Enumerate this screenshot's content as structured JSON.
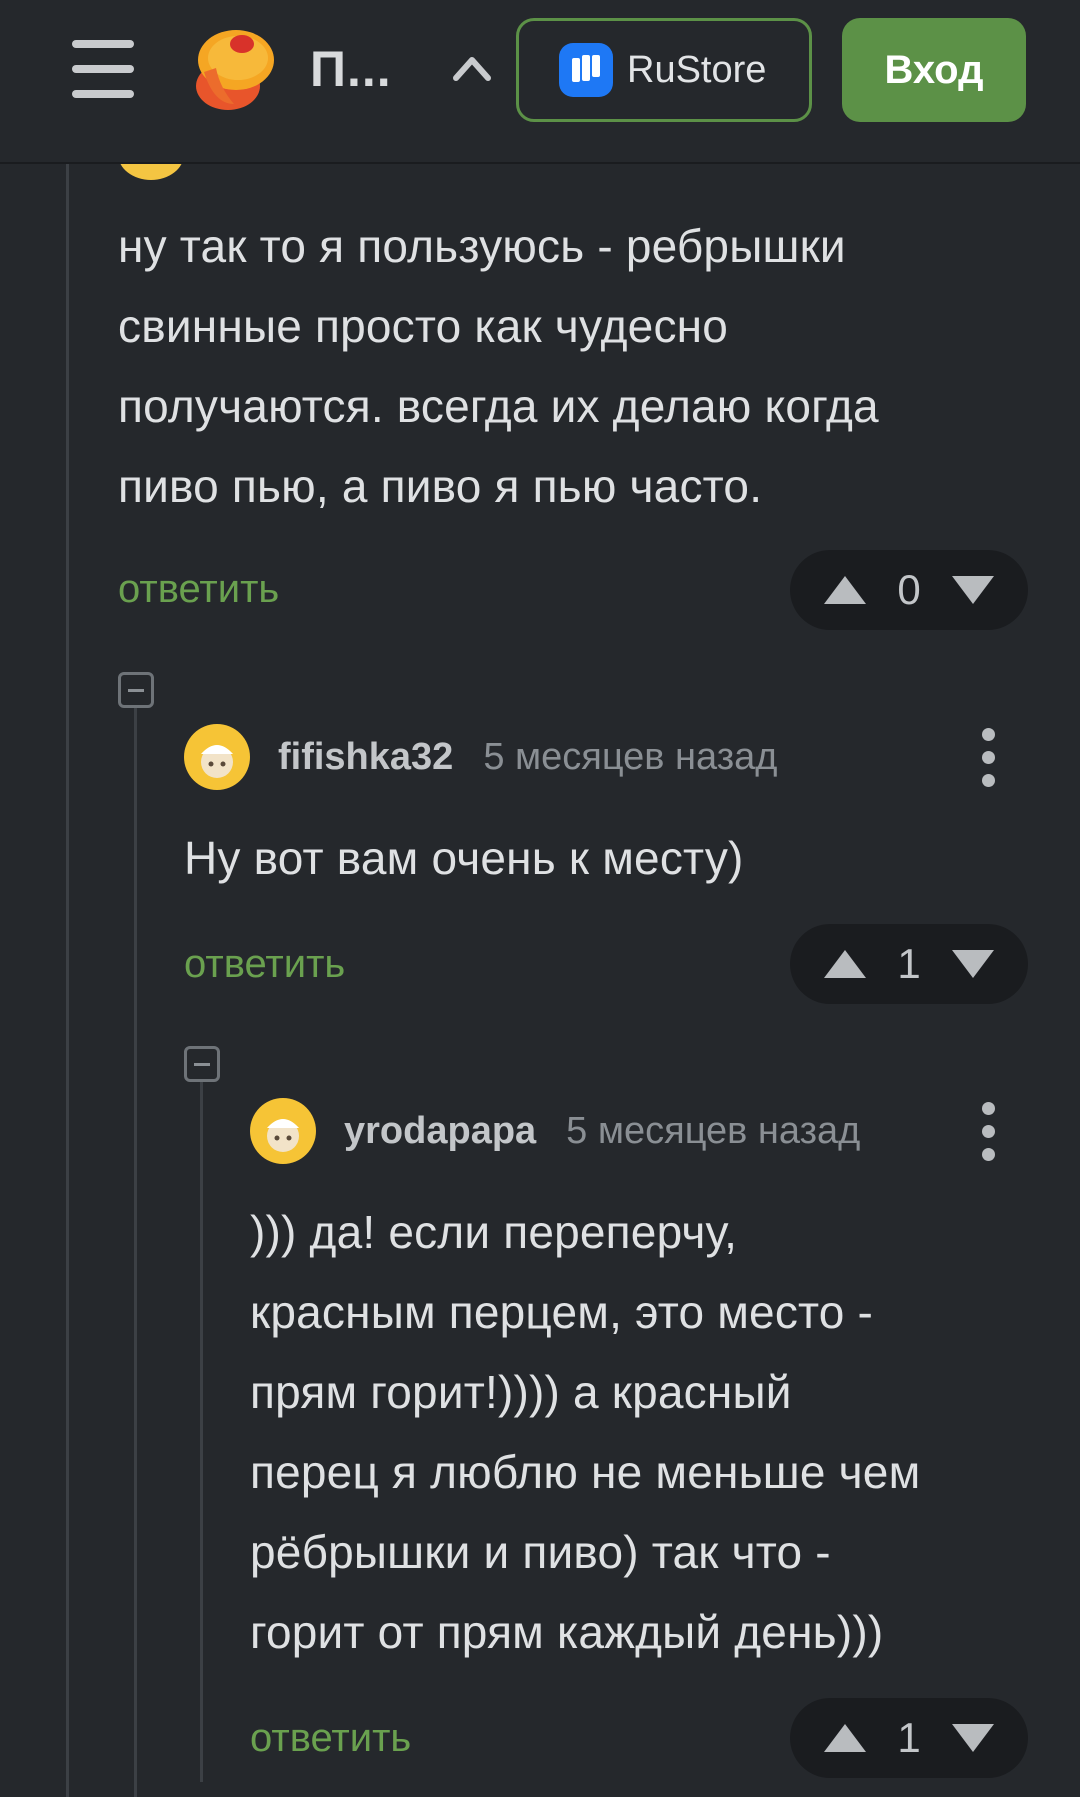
{
  "header": {
    "site_title": "П...",
    "rustore_label": "RuStore",
    "login_label": "Вход",
    "icons": [
      "menu-icon",
      "site-logo",
      "chevron-up-icon",
      "rustore-icon"
    ],
    "accent_color": "#5c9147"
  },
  "comments": [
    {
      "text_lines": [
        "ну так то я пользуюсь - ребрышки",
        "свинные просто как чудесно",
        "получаются. всегда их делаю когда",
        "пиво пью, а пиво я пью часто."
      ],
      "reply_label": "ответить",
      "rating": "0"
    },
    {
      "author": "fifishka32",
      "time": "5 месяцев назад",
      "text_lines": [
        "Ну вот вам очень к месту)"
      ],
      "reply_label": "ответить",
      "rating": "1"
    },
    {
      "author": "yrodapapa",
      "time": "5 месяцев назад",
      "text_lines": [
        "))) да! если переперчу,",
        "красным перцем, это место -",
        "прям горит!)))) а красный",
        "перец я люблю не меньше чем",
        "рёбрышки и пиво) так что -",
        "горит от прям каждый день)))"
      ],
      "reply_label": "ответить",
      "rating": "1"
    }
  ]
}
